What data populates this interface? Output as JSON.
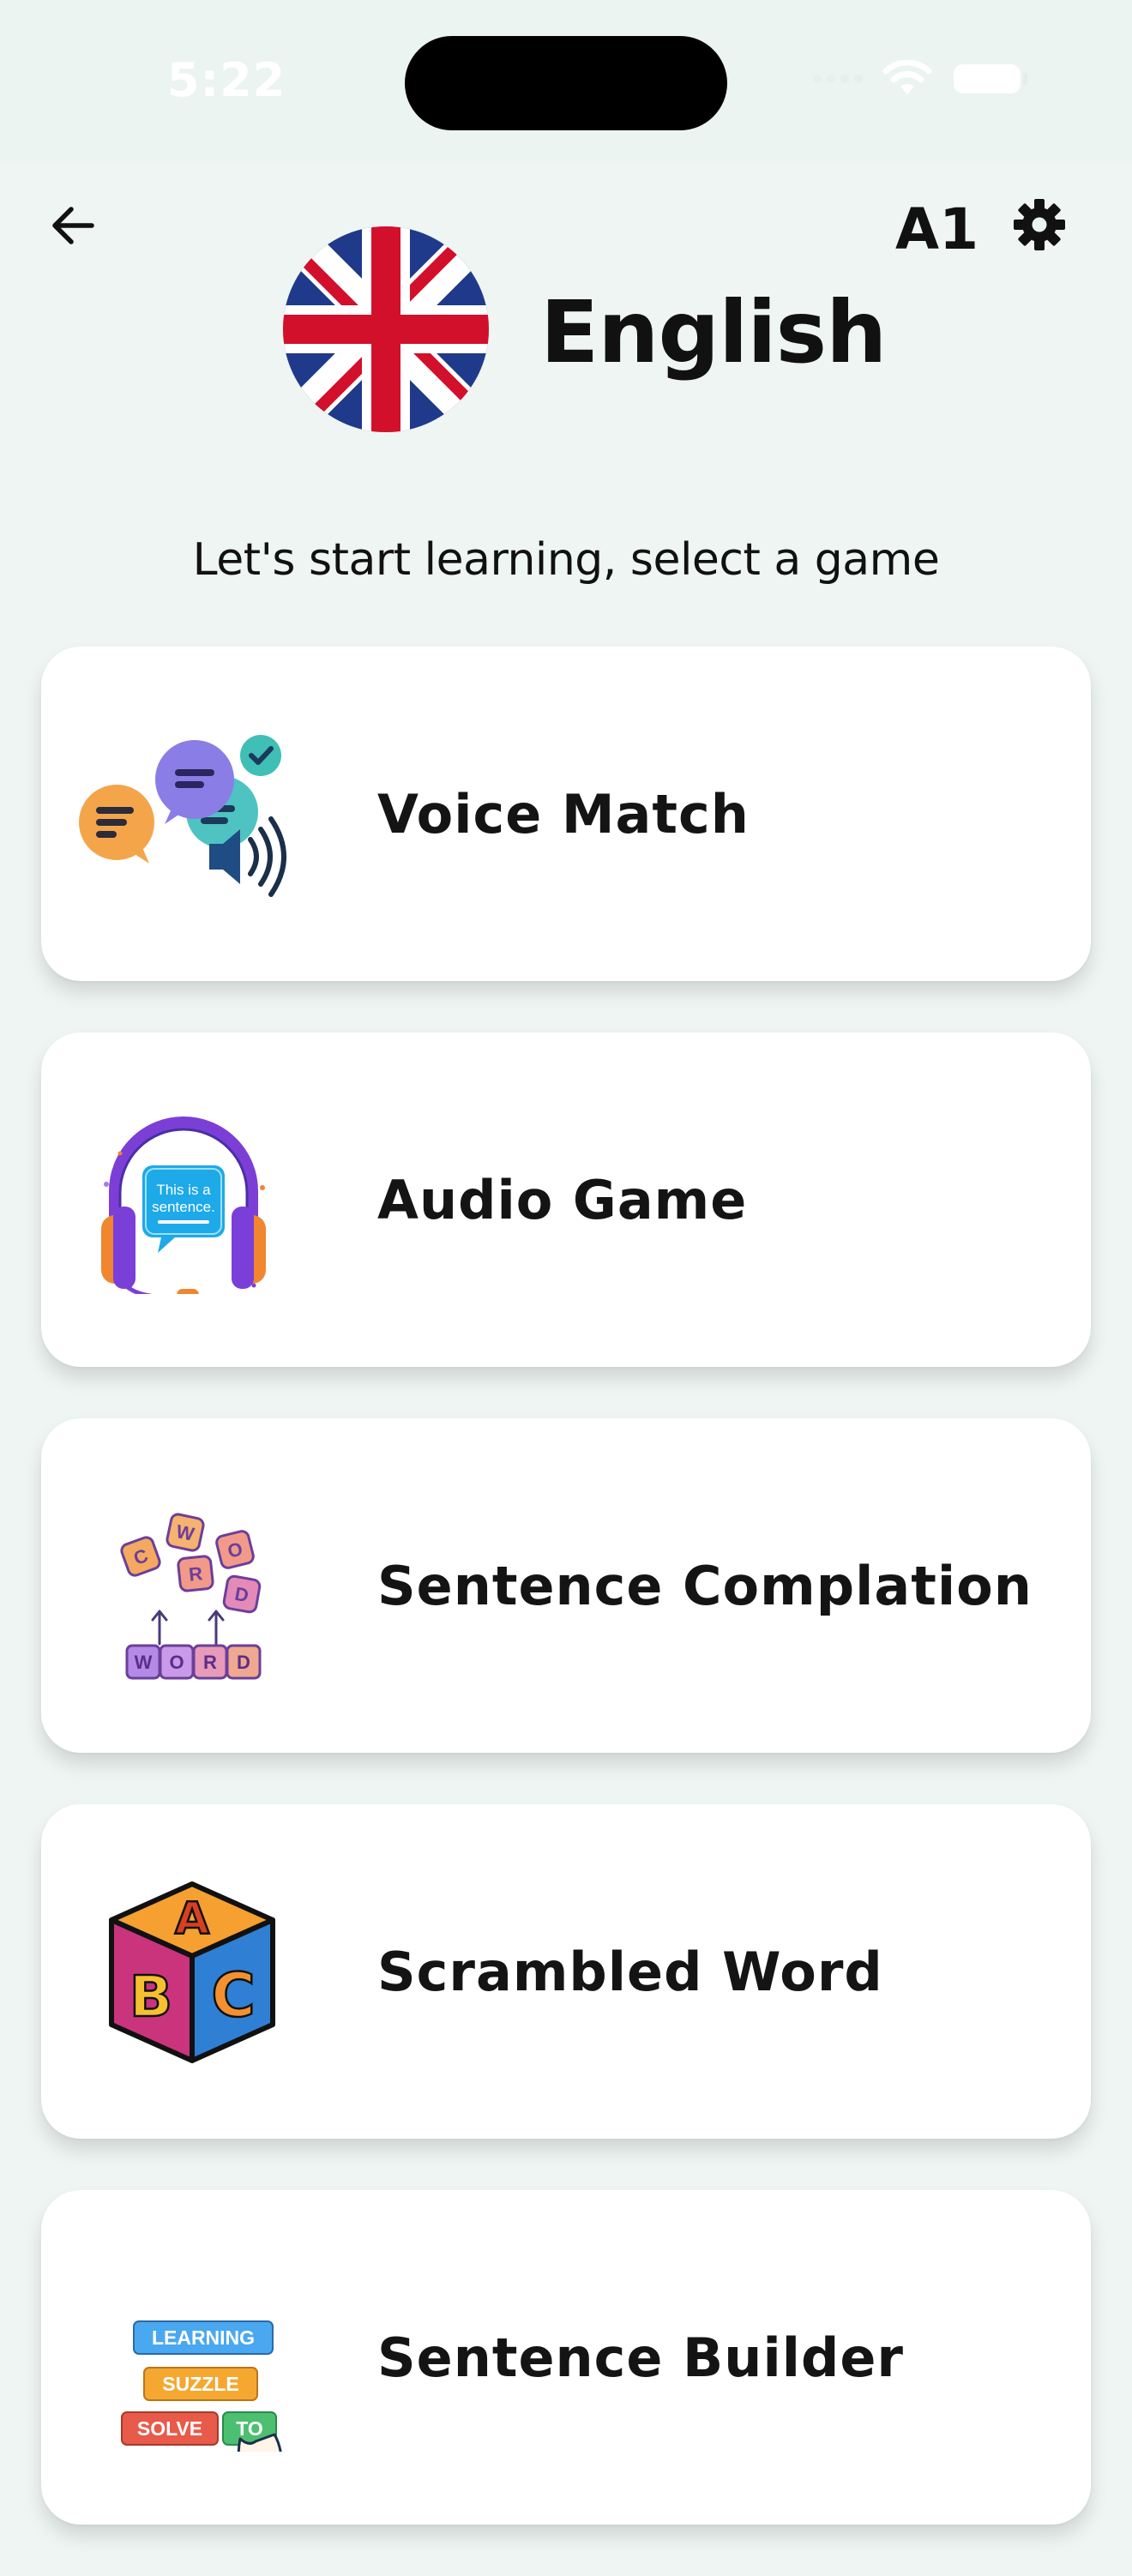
{
  "status": {
    "time": "5:22"
  },
  "header": {
    "level": "A1",
    "language": "English",
    "back_icon": "arrow-left-icon",
    "settings_icon": "gear-icon",
    "flag_icon": "uk-flag-icon"
  },
  "subtitle": "Let's start learning, select a game",
  "games": [
    {
      "label": "Voice Match",
      "icon": "chat-bubbles-speaker-icon"
    },
    {
      "label": "Audio Game",
      "icon": "headphones-sentence-icon",
      "icon_text_line1": "This is a",
      "icon_text_line2": "sentence."
    },
    {
      "label": "Sentence Complation",
      "icon": "word-tiles-icon",
      "icon_letters_top": [
        "C",
        "W",
        "O",
        "R",
        "D"
      ],
      "icon_letters_bottom": [
        "W",
        "O",
        "R",
        "D"
      ]
    },
    {
      "label": "Scrambled Word",
      "icon": "abc-block-icon",
      "icon_letters": [
        "A",
        "B",
        "C"
      ]
    },
    {
      "label": "Sentence Builder",
      "icon": "word-blocks-hand-icon",
      "icon_words": [
        "LEARNING",
        "SUZZLE",
        "SOLVE",
        "TO"
      ]
    }
  ],
  "colors": {
    "background": "#eef5f2",
    "card": "#ffffff",
    "text": "#111111"
  }
}
